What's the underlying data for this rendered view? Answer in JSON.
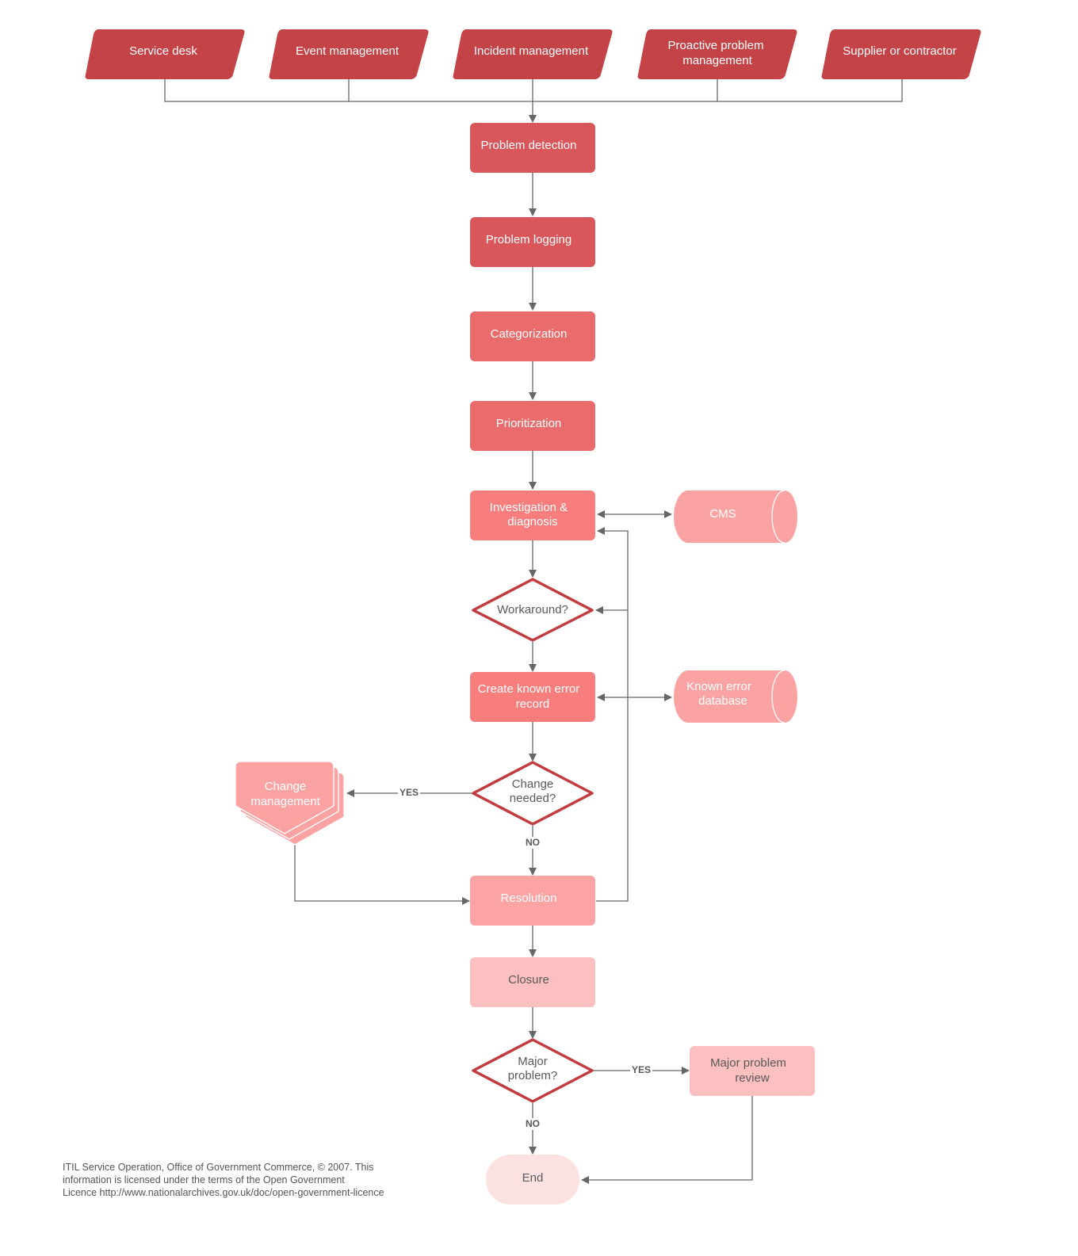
{
  "inputs": [
    {
      "label": "Service desk"
    },
    {
      "label": "Event management"
    },
    {
      "label": "Incident management"
    },
    {
      "label": "Proactive problem management"
    },
    {
      "label": "Supplier or contractor"
    }
  ],
  "steps": {
    "problem_detection": "Problem detection",
    "problem_logging": "Problem logging",
    "categorization": "Categorization",
    "prioritization": "Prioritization",
    "investigation": "Investigation & diagnosis",
    "workaround": "Workaround?",
    "known_error_record": "Create known error record",
    "change_needed": "Change needed?",
    "change_management": "Change management",
    "resolution": "Resolution",
    "closure": "Closure",
    "major_problem": "Major problem?",
    "major_problem_review": "Major problem review",
    "end": "End"
  },
  "stores": {
    "cms": "CMS",
    "known_error_db": "Known error database"
  },
  "edge_labels": {
    "yes": "YES",
    "no": "NO"
  },
  "colors": {
    "input": "#c44347",
    "detection": "#d9575b",
    "categorization": "#ea6b6b",
    "investigation": "#f87e7e",
    "store": "#fba3a3",
    "resolution": "#fca3a3",
    "closure": "#fdc0c0",
    "end": "#fde2e2",
    "decision_border": "#c23b3f",
    "connector": "#666666"
  },
  "footer": {
    "line1": "ITIL Service Operation, Office of Government Commerce, © 2007. This",
    "line2": "information is licensed under the terms of the Open Government",
    "line3": "Licence http://www.nationalarchives.gov.uk/doc/open-government-licence"
  }
}
